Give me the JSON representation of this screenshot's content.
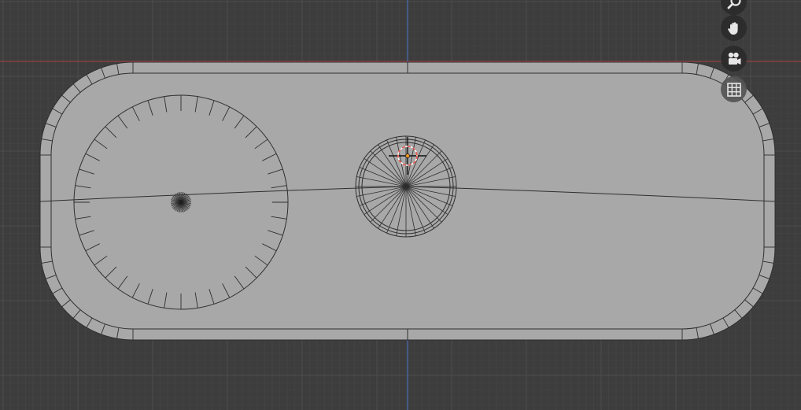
{
  "viewport": {
    "mode": "3d-viewport-top-orthographic",
    "background_color": "#3d3d3d",
    "grid_color": "#474747",
    "x_axis_color": "#a94445",
    "y_axis_color": "#4a72c4",
    "mesh_fill_color": "#a8a8a8",
    "wire_color": "#2e2e2e",
    "cursor_color_primary": "#e8544a",
    "cursor_color_secondary": "#ffffff",
    "origin_color": "#f29421"
  },
  "navigation": {
    "zoom_icon": "magnifier-icon",
    "pan_icon": "hand-icon",
    "camera_icon": "camera-icon",
    "perspective_icon": "grid-icon"
  }
}
